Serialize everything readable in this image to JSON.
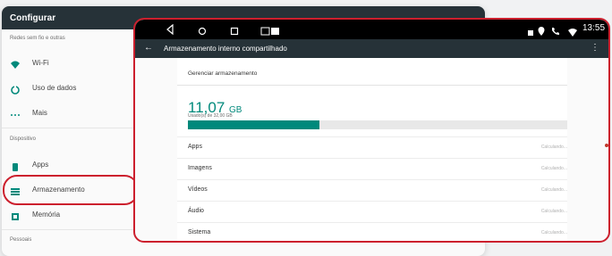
{
  "settings": {
    "title": "Configurar",
    "sections": {
      "wireless": "Redes sem fio e outras",
      "device": "Dispositivo",
      "personal": "Pessoais"
    },
    "items": {
      "wifi": "Wi-Fi",
      "data_usage": "Uso de dados",
      "more": "Mais",
      "apps": "Apps",
      "storage": "Armazenamento",
      "memory": "Memória"
    }
  },
  "status_bar": {
    "time": "13:55"
  },
  "storage": {
    "title": "Armazenamento interno compartilhado",
    "manage_label": "Gerenciar armazenamento",
    "used_amount": "11,07",
    "used_unit": "GB",
    "used_of": "Usado(s) de 32,00 GB",
    "used_fraction": 0.346,
    "rows": [
      {
        "name": "Apps",
        "value": "Calculando..."
      },
      {
        "name": "Imagens",
        "value": "Calculando..."
      },
      {
        "name": "Vídeos",
        "value": "Calculando..."
      },
      {
        "name": "Áudio",
        "value": "Calculando..."
      },
      {
        "name": "Sistema",
        "value": "Calculando..."
      }
    ]
  },
  "colors": {
    "accent": "#00897b",
    "highlight": "#cc1f2d",
    "app_bar": "#263238"
  }
}
